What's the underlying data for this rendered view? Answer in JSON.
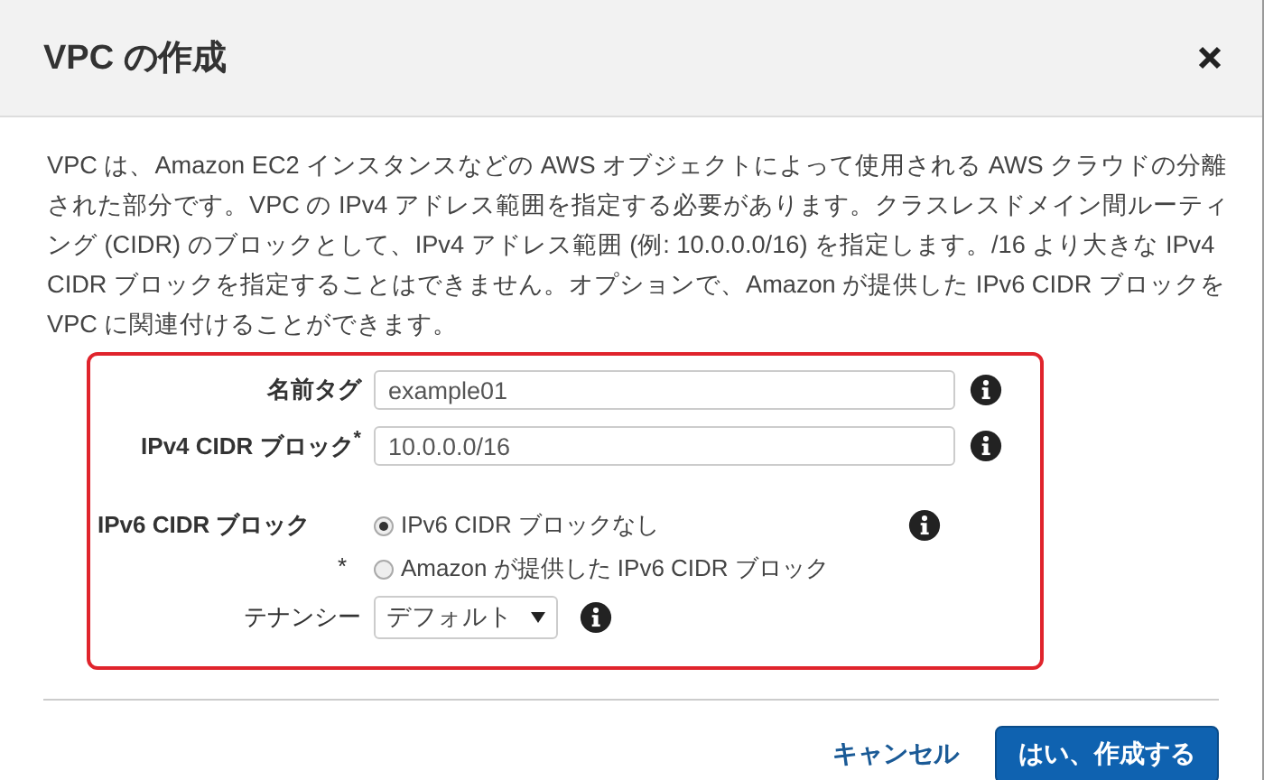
{
  "dialog": {
    "title": "VPC の作成"
  },
  "description": "VPC は、Amazon EC2 インスタンスなどの AWS オブジェクトによって使用される AWS クラウドの分離された部分です。VPC の IPv4 アドレス範囲を指定する必要があります。クラスレスドメイン間ルーティング (CIDR) のブロックとして、IPv4 アドレス範囲 (例: 10.0.0.0/16) を指定します。/16 より大きな IPv4 CIDR ブロックを指定することはできません。オプションで、Amazon が提供した IPv6 CIDR ブロックを VPC に関連付けることができます。",
  "form": {
    "highlighted": true,
    "fields": [
      {
        "kind": "text",
        "label": "名前タグ",
        "strong": true,
        "value": "example01"
      },
      {
        "kind": "text",
        "label": "IPv4 CIDR ブロック$^{*}$",
        "strong": true,
        "value": "10.0.0.0/16"
      },
      {
        "kind": "radio",
        "label": "IPv6 CIDR ブロック",
        "strong": true,
        "required_mark": "*",
        "options": [
          {
            "label": "IPv6 CIDR ブロックなし",
            "selected": true
          },
          {
            "label": "Amazon が提供した IPv6 CIDR ブロック",
            "selected": false
          }
        ]
      },
      {
        "kind": "select",
        "label": "テナンシー",
        "strong": false,
        "value": "デフォルト"
      }
    ]
  },
  "buttons": {
    "cancel": "キャンセル",
    "confirm": "はい、作成する"
  }
}
